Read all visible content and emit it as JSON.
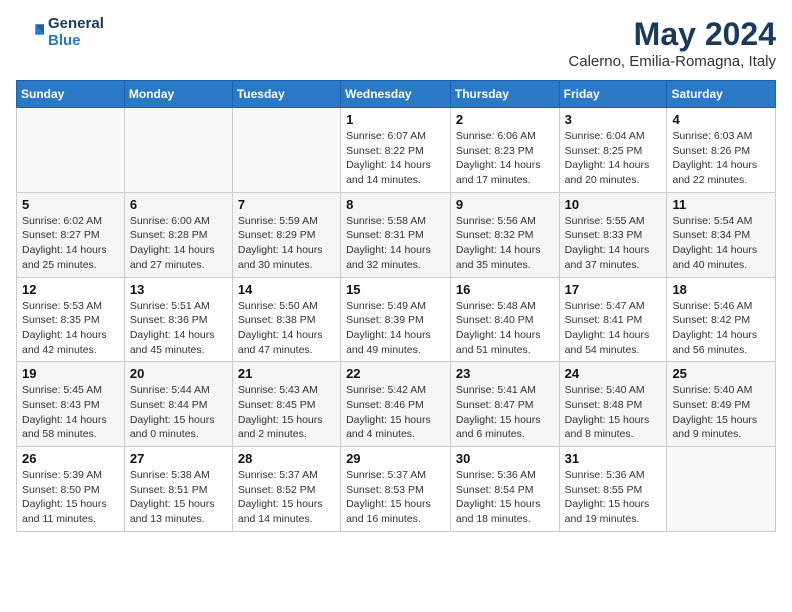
{
  "header": {
    "logo_line1": "General",
    "logo_line2": "Blue",
    "month_year": "May 2024",
    "location": "Calerno, Emilia-Romagna, Italy"
  },
  "weekdays": [
    "Sunday",
    "Monday",
    "Tuesday",
    "Wednesday",
    "Thursday",
    "Friday",
    "Saturday"
  ],
  "weeks": [
    [
      {
        "num": "",
        "info": ""
      },
      {
        "num": "",
        "info": ""
      },
      {
        "num": "",
        "info": ""
      },
      {
        "num": "1",
        "info": "Sunrise: 6:07 AM\nSunset: 8:22 PM\nDaylight: 14 hours and 14 minutes."
      },
      {
        "num": "2",
        "info": "Sunrise: 6:06 AM\nSunset: 8:23 PM\nDaylight: 14 hours and 17 minutes."
      },
      {
        "num": "3",
        "info": "Sunrise: 6:04 AM\nSunset: 8:25 PM\nDaylight: 14 hours and 20 minutes."
      },
      {
        "num": "4",
        "info": "Sunrise: 6:03 AM\nSunset: 8:26 PM\nDaylight: 14 hours and 22 minutes."
      }
    ],
    [
      {
        "num": "5",
        "info": "Sunrise: 6:02 AM\nSunset: 8:27 PM\nDaylight: 14 hours and 25 minutes."
      },
      {
        "num": "6",
        "info": "Sunrise: 6:00 AM\nSunset: 8:28 PM\nDaylight: 14 hours and 27 minutes."
      },
      {
        "num": "7",
        "info": "Sunrise: 5:59 AM\nSunset: 8:29 PM\nDaylight: 14 hours and 30 minutes."
      },
      {
        "num": "8",
        "info": "Sunrise: 5:58 AM\nSunset: 8:31 PM\nDaylight: 14 hours and 32 minutes."
      },
      {
        "num": "9",
        "info": "Sunrise: 5:56 AM\nSunset: 8:32 PM\nDaylight: 14 hours and 35 minutes."
      },
      {
        "num": "10",
        "info": "Sunrise: 5:55 AM\nSunset: 8:33 PM\nDaylight: 14 hours and 37 minutes."
      },
      {
        "num": "11",
        "info": "Sunrise: 5:54 AM\nSunset: 8:34 PM\nDaylight: 14 hours and 40 minutes."
      }
    ],
    [
      {
        "num": "12",
        "info": "Sunrise: 5:53 AM\nSunset: 8:35 PM\nDaylight: 14 hours and 42 minutes."
      },
      {
        "num": "13",
        "info": "Sunrise: 5:51 AM\nSunset: 8:36 PM\nDaylight: 14 hours and 45 minutes."
      },
      {
        "num": "14",
        "info": "Sunrise: 5:50 AM\nSunset: 8:38 PM\nDaylight: 14 hours and 47 minutes."
      },
      {
        "num": "15",
        "info": "Sunrise: 5:49 AM\nSunset: 8:39 PM\nDaylight: 14 hours and 49 minutes."
      },
      {
        "num": "16",
        "info": "Sunrise: 5:48 AM\nSunset: 8:40 PM\nDaylight: 14 hours and 51 minutes."
      },
      {
        "num": "17",
        "info": "Sunrise: 5:47 AM\nSunset: 8:41 PM\nDaylight: 14 hours and 54 minutes."
      },
      {
        "num": "18",
        "info": "Sunrise: 5:46 AM\nSunset: 8:42 PM\nDaylight: 14 hours and 56 minutes."
      }
    ],
    [
      {
        "num": "19",
        "info": "Sunrise: 5:45 AM\nSunset: 8:43 PM\nDaylight: 14 hours and 58 minutes."
      },
      {
        "num": "20",
        "info": "Sunrise: 5:44 AM\nSunset: 8:44 PM\nDaylight: 15 hours and 0 minutes."
      },
      {
        "num": "21",
        "info": "Sunrise: 5:43 AM\nSunset: 8:45 PM\nDaylight: 15 hours and 2 minutes."
      },
      {
        "num": "22",
        "info": "Sunrise: 5:42 AM\nSunset: 8:46 PM\nDaylight: 15 hours and 4 minutes."
      },
      {
        "num": "23",
        "info": "Sunrise: 5:41 AM\nSunset: 8:47 PM\nDaylight: 15 hours and 6 minutes."
      },
      {
        "num": "24",
        "info": "Sunrise: 5:40 AM\nSunset: 8:48 PM\nDaylight: 15 hours and 8 minutes."
      },
      {
        "num": "25",
        "info": "Sunrise: 5:40 AM\nSunset: 8:49 PM\nDaylight: 15 hours and 9 minutes."
      }
    ],
    [
      {
        "num": "26",
        "info": "Sunrise: 5:39 AM\nSunset: 8:50 PM\nDaylight: 15 hours and 11 minutes."
      },
      {
        "num": "27",
        "info": "Sunrise: 5:38 AM\nSunset: 8:51 PM\nDaylight: 15 hours and 13 minutes."
      },
      {
        "num": "28",
        "info": "Sunrise: 5:37 AM\nSunset: 8:52 PM\nDaylight: 15 hours and 14 minutes."
      },
      {
        "num": "29",
        "info": "Sunrise: 5:37 AM\nSunset: 8:53 PM\nDaylight: 15 hours and 16 minutes."
      },
      {
        "num": "30",
        "info": "Sunrise: 5:36 AM\nSunset: 8:54 PM\nDaylight: 15 hours and 18 minutes."
      },
      {
        "num": "31",
        "info": "Sunrise: 5:36 AM\nSunset: 8:55 PM\nDaylight: 15 hours and 19 minutes."
      },
      {
        "num": "",
        "info": ""
      }
    ]
  ]
}
